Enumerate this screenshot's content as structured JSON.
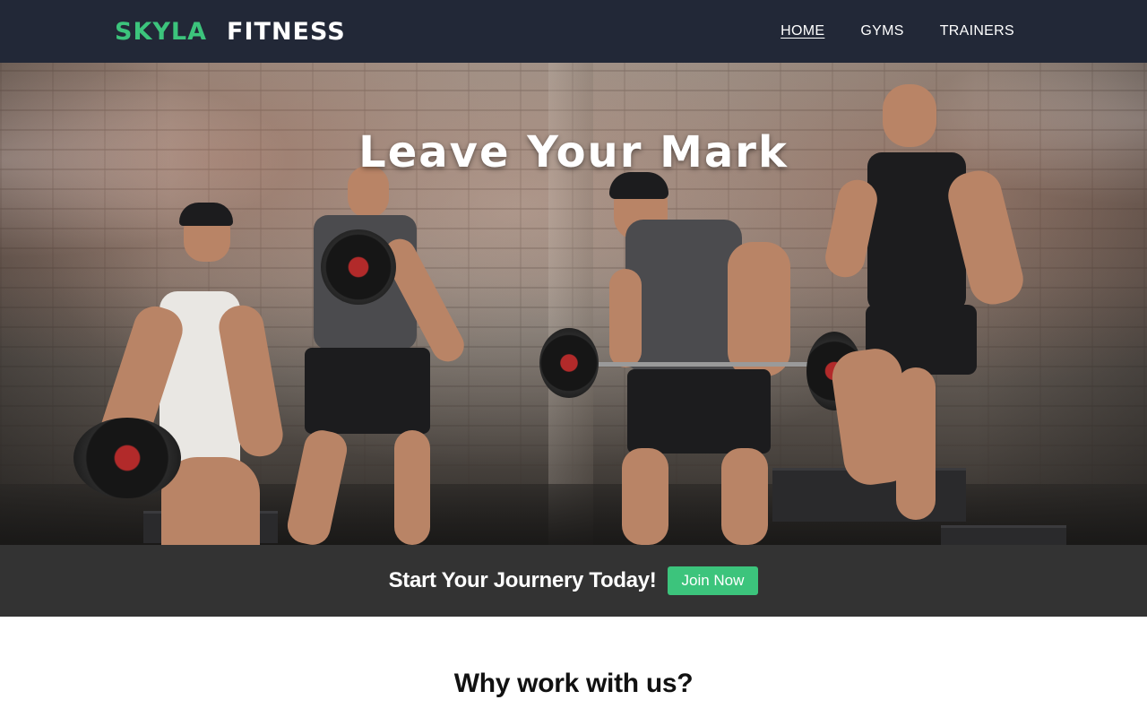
{
  "header": {
    "logo_part1": "SKYLA",
    "logo_part2": "FITNESS",
    "nav": [
      {
        "label": "HOME",
        "active": true
      },
      {
        "label": "GYMS",
        "active": false
      },
      {
        "label": "TRAINERS",
        "active": false
      }
    ]
  },
  "hero": {
    "title": "Leave Your Mark",
    "image": "group-of-athletes-training-with-weights"
  },
  "cta": {
    "text": "Start Your Journery Today!",
    "button_label": "Join Now"
  },
  "why": {
    "title": "Why work with us?",
    "subtitle": ""
  },
  "colors": {
    "header_bg": "#222837",
    "accent": "#3cc47c",
    "cta_bg": "#333333"
  }
}
